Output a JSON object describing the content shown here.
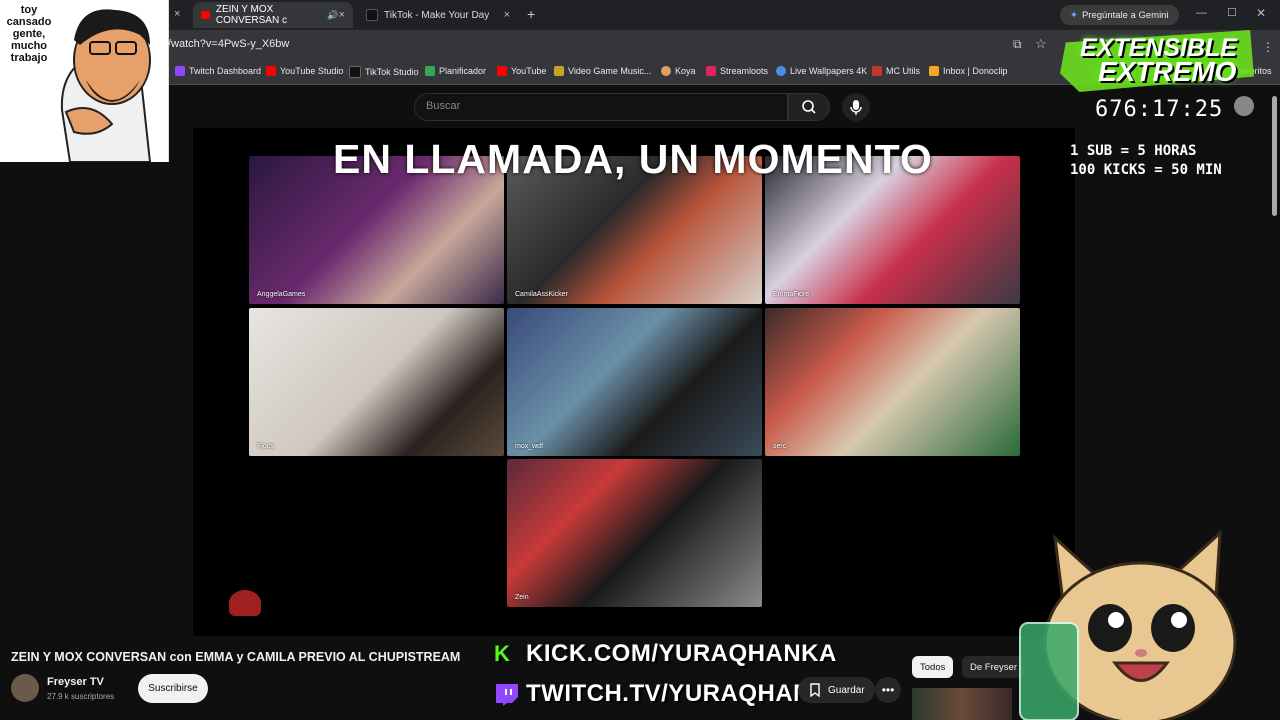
{
  "browser": {
    "tabs": [
      {
        "label": "ZEIN Y MOX CONVERSAN c",
        "close": "×"
      },
      {
        "label": "TikTok - Make Your Day",
        "close": "×"
      }
    ],
    "first_tab_close": "×",
    "new_tab": "+",
    "gemini": "Pregúntale a Gemini",
    "url": "/watch?v=4PwS-y_X6bw",
    "bookmarks": [
      {
        "label": "Twitch Dashboard",
        "color": "#9146ff"
      },
      {
        "label": "YouTube Studio",
        "color": "#ff0000"
      },
      {
        "label": "TikTok Studio",
        "color": "#111111"
      },
      {
        "label": "Planificador",
        "color": "#34a853"
      },
      {
        "label": "YouTube",
        "color": "#ff0000"
      },
      {
        "label": "Video Game Music...",
        "color": "#c9a227"
      },
      {
        "label": "Koya",
        "color": "#e0a060"
      },
      {
        "label": "Streamloots",
        "color": "#e0245e"
      },
      {
        "label": "Live Wallpapers 4K",
        "color": "#4a90e2"
      },
      {
        "label": "MC Utils",
        "color": "#c0392b"
      },
      {
        "label": "Inbox | Donoclip",
        "color": "#f5a623"
      }
    ],
    "bookmarks_more": "avoritos"
  },
  "youtube": {
    "search_placeholder": "Buscar",
    "video_title": "ZEIN Y MOX CONVERSAN con EMMA y CAMILA PREVIO AL CHUPISTREAM",
    "channel_name": "Freyser TV",
    "channel_subs": "27.9 k suscriptores",
    "subscribe": "Suscribirse",
    "save": "Guardar",
    "chips": [
      "Todos",
      "De Freyser"
    ]
  },
  "call": {
    "title": "EN LLAMADA, UN MOMENTO",
    "participants": [
      "AnggelaGames",
      "CamilaAssKicker",
      "EmmaFiore",
      "Flocs",
      "mox_wdf",
      "serc",
      "Zein"
    ]
  },
  "overlay": {
    "speech": "toy cansado gente, mucho trabajo",
    "logo_line1": "EXTENSIBLE",
    "logo_line2": "EXTREMO",
    "timer": "676:17:25",
    "rule1": "1 SUB = 5 HORAS",
    "rule2": "100 KICKS = 50 MIN",
    "kick_url": "KICK.COM/YURAQHANKA",
    "twitch_url": "TWITCH.TV/YURAQHANKAA"
  },
  "colors": {
    "kick": "#53fc18",
    "twitch": "#9146ff",
    "logo_green": "#6ddf1f"
  }
}
